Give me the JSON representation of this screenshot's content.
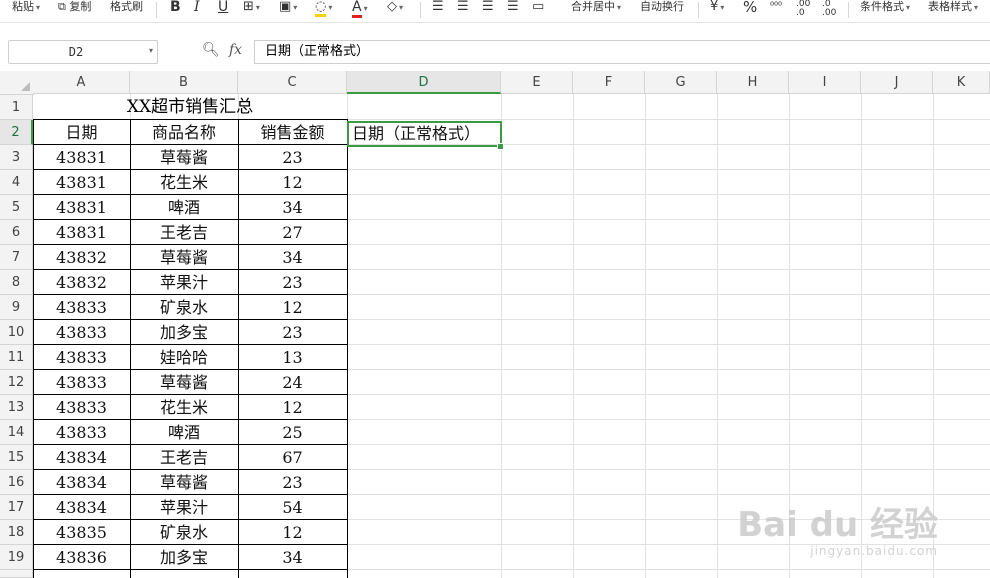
{
  "toolbar": {
    "paste": "粘贴",
    "copy": "复制",
    "format_painter": "格式刷",
    "bold": "B",
    "italic": "I",
    "underline": "U",
    "font_color": "A",
    "merge_center": "合并居中",
    "wrap": "自动换行",
    "percent": "%",
    "inc_dec1": ".00\n.0",
    "inc_dec2": ".0\n.00",
    "cond_format": "条件格式",
    "table_style": "表格样式"
  },
  "formula_bar": {
    "name_box": "D2",
    "fx": "fx",
    "value": "日期（正常格式）"
  },
  "columns": [
    "A",
    "B",
    "C",
    "D",
    "E",
    "F",
    "G",
    "H",
    "I",
    "J",
    "K"
  ],
  "active_col": "D",
  "active_row": "2",
  "rows": [
    "1",
    "2",
    "3",
    "4",
    "5",
    "6",
    "7",
    "8",
    "9",
    "10",
    "11",
    "12",
    "13",
    "14",
    "15",
    "16",
    "17",
    "18",
    "19"
  ],
  "sheet": {
    "title": "XX超市销售汇总",
    "headers": [
      "日期",
      "商品名称",
      "销售金额"
    ],
    "d2": "日期（正常格式）",
    "data": [
      [
        "43831",
        "草莓酱",
        "23"
      ],
      [
        "43831",
        "花生米",
        "12"
      ],
      [
        "43831",
        "啤酒",
        "34"
      ],
      [
        "43831",
        "王老吉",
        "27"
      ],
      [
        "43832",
        "草莓酱",
        "34"
      ],
      [
        "43832",
        "苹果汁",
        "23"
      ],
      [
        "43833",
        "矿泉水",
        "12"
      ],
      [
        "43833",
        "加多宝",
        "23"
      ],
      [
        "43833",
        "娃哈哈",
        "13"
      ],
      [
        "43833",
        "草莓酱",
        "24"
      ],
      [
        "43833",
        "花生米",
        "12"
      ],
      [
        "43833",
        "啤酒",
        "25"
      ],
      [
        "43834",
        "王老吉",
        "67"
      ],
      [
        "43834",
        "草莓酱",
        "23"
      ],
      [
        "43834",
        "苹果汁",
        "54"
      ],
      [
        "43835",
        "矿泉水",
        "12"
      ],
      [
        "43836",
        "加多宝",
        "34"
      ]
    ]
  },
  "watermark": {
    "main": "Bai du 经验",
    "sub": "jingyan.baidu.com"
  }
}
